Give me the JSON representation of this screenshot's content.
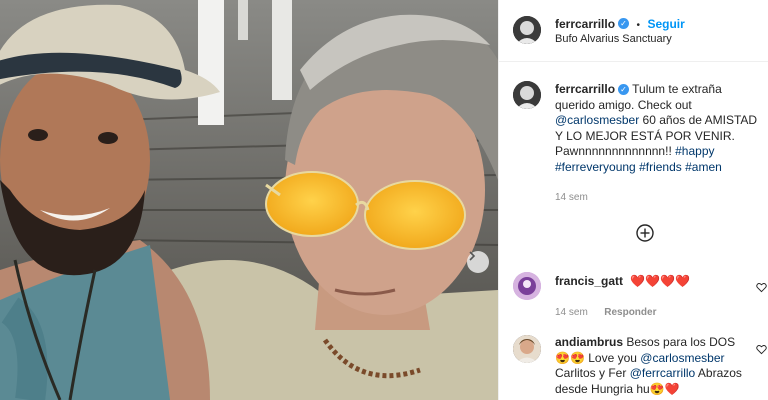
{
  "post": {
    "username": "ferrcarrillo",
    "follow_label": "Seguir",
    "separator": "•",
    "location": "Bufo Alvarius Sanctuary",
    "caption_pre": "Tulum te extraña querido amigo. Check out",
    "caption_mention": "@carlosmesber",
    "caption_mid": " 60 años de AMISTAD Y LO MEJOR ESTÁ POR VENIR. Pawnnnnnnnnnnnnn!!",
    "caption_tags": [
      "#happy",
      "#ferreveryoung",
      "#friends",
      "#amen"
    ],
    "caption_time": "14 sem"
  },
  "comments": [
    {
      "username": "francis_gatt",
      "text": "❤️❤️❤️❤️",
      "time": "14 sem",
      "reply_label": "Responder"
    },
    {
      "username": "andiambrus",
      "text_line1": "Besos para los DOS",
      "text_emoji": "😍😍",
      "text_line2": "Love you",
      "mention1": "@carlosmesber",
      "text_line3": "Carlitos y Fer",
      "mention2": "@ferrcarrillo",
      "text_line4": "Abrazos desde Hungria hu😍❤️"
    }
  ],
  "icons": {
    "verified": "verified-badge-icon",
    "next": "chevron-right-icon",
    "load_more": "plus-circle-icon",
    "like": "heart-icon"
  },
  "colors": {
    "link": "#00376b",
    "accent": "#0095f6",
    "verified": "#3897f0",
    "meta": "#8e8e8e"
  }
}
